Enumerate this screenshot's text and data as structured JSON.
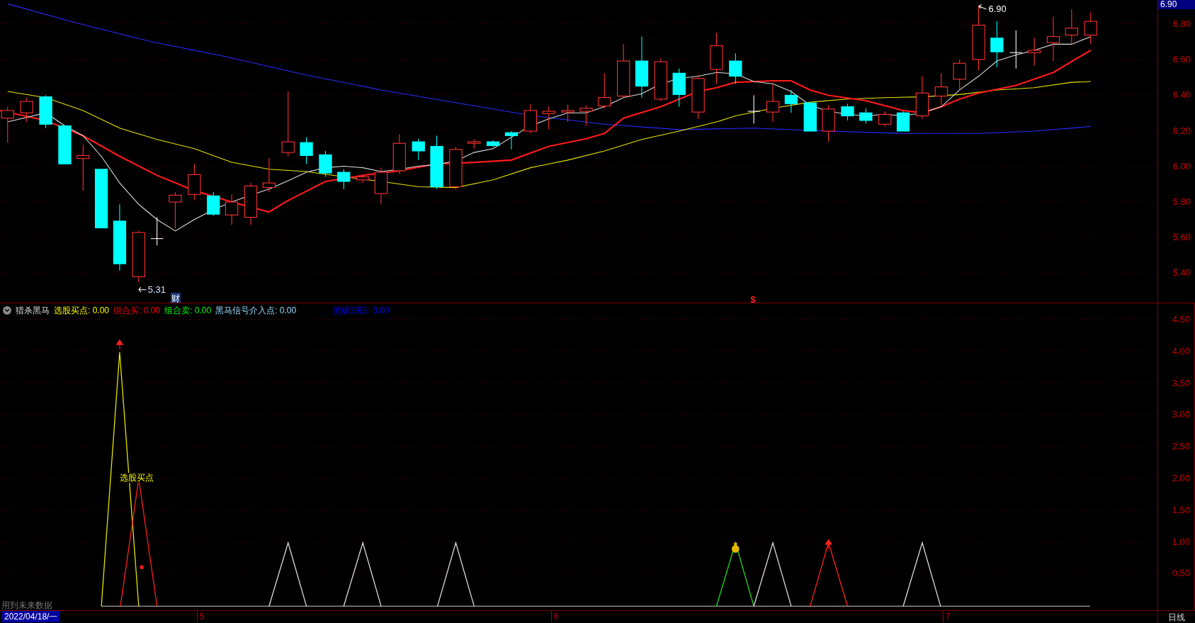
{
  "price_chart": {
    "last_price": "6.90",
    "high_label": "6.90",
    "low_label": "5.31",
    "markers": [
      {
        "kind": "finance",
        "text": "财"
      },
      {
        "kind": "signal",
        "text": "$"
      }
    ],
    "axis_ticks": [
      "6.80",
      "6.60",
      "6.40",
      "6.20",
      "6.00",
      "5.80",
      "5.60",
      "5.40"
    ]
  },
  "indicator": {
    "name": "猎杀黑马",
    "legend": [
      {
        "text": "选股买点: 0.00",
        "kind": "pick"
      },
      {
        "text": "组合买: 0.00",
        "kind": "buy"
      },
      {
        "text": "组合卖: 0.00",
        "kind": "sell"
      },
      {
        "text": "黑马信号介入点: 0.00",
        "kind": "entry"
      },
      {
        "text": "突破20日: 0.00",
        "kind": "breakout"
      }
    ],
    "signal_label": "选股买点",
    "warning": "用到未来数据",
    "axis_ticks": [
      "4.50",
      "4.00",
      "3.50",
      "3.00",
      "2.50",
      "2.00",
      "1.50",
      "1.00",
      "0.50"
    ]
  },
  "time_axis": {
    "date": "2022/04/18/一",
    "months": [
      "5",
      "6",
      "7"
    ],
    "period": "日线"
  }
}
